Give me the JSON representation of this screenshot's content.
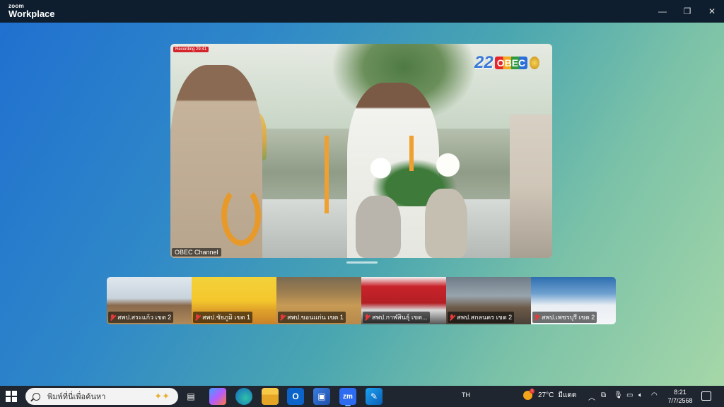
{
  "app": {
    "brand_line1": "zoom",
    "brand_line2": "Workplace"
  },
  "window_controls": {
    "minimize_icon": "—",
    "maximize_icon": "❐",
    "close_icon": "✕"
  },
  "main_video": {
    "recording_badge": "Recording 29:41",
    "channel_number": "22",
    "channel_name": "OBEC",
    "participant_name": "OBEC Channel"
  },
  "thumbnails": [
    {
      "name": "สพป.สระแก้ว เขต 2",
      "muted": true
    },
    {
      "name": "สพป.ชัยภูมิ เขต 1",
      "muted": true
    },
    {
      "name": "สพป.ขอนแก่น เขต 1",
      "muted": true
    },
    {
      "name": "สพป.กาฬสินธุ์ เขต...",
      "muted": true
    },
    {
      "name": "สพป.สกลนคร เขต 2",
      "muted": true
    },
    {
      "name": "สพป.เพชรบุรี เขต 2",
      "muted": true
    }
  ],
  "taskbar": {
    "search_placeholder": "พิมพ์ที่นี่เพื่อค้นหา",
    "apps": [
      "task-view",
      "copilot",
      "edge",
      "file-explorer",
      "outlook",
      "store",
      "zoom",
      "whiteboard"
    ],
    "active_app": "zoom",
    "zoom_icon_text": "zm",
    "language": "TH",
    "weather_badge": "1",
    "temperature": "27°C",
    "weather_text": "มีแดด",
    "time": "8:21",
    "date": "7/7/2568"
  },
  "colors": {
    "titlebar": "#0e1e2e",
    "taskbar": "#1f2630",
    "record_red": "#d4242a",
    "muted_red": "#e43a3a"
  }
}
